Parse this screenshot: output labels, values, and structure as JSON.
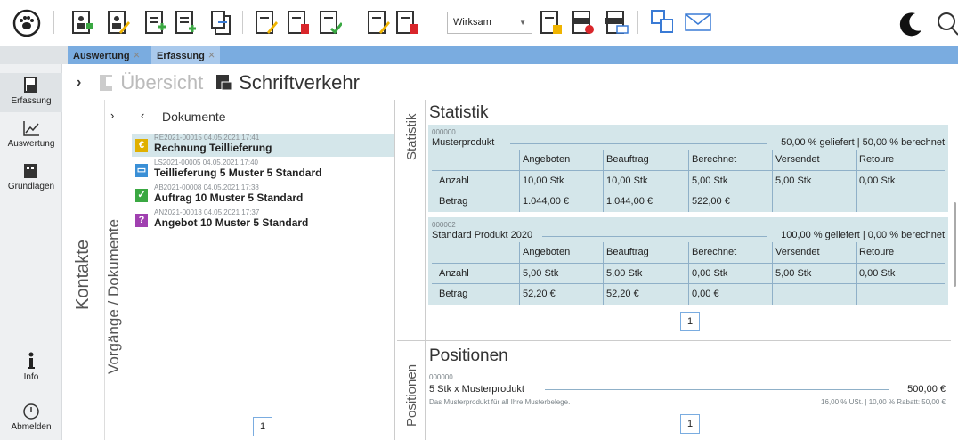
{
  "toolbar": {
    "status_value": "Wirksam",
    "colors": {
      "blue": "#3a7bd5",
      "green": "#3aa842",
      "red": "#d9262b",
      "yellow": "#f0b400",
      "dark": "#333333"
    }
  },
  "tabs": [
    {
      "label": "Auswertung",
      "close": "×"
    },
    {
      "label": "Erfassung",
      "close": "×"
    }
  ],
  "sidebar": {
    "items": [
      {
        "label": "Erfassung",
        "icon": "erfassung-icon"
      },
      {
        "label": "Auswertung",
        "icon": "chart-icon"
      },
      {
        "label": "Grundlagen",
        "icon": "grundlagen-icon"
      },
      {
        "label": "Info",
        "icon": "info-icon"
      },
      {
        "label": "Abmelden",
        "icon": "power-icon"
      }
    ]
  },
  "header": {
    "overview": "Übersicht",
    "correspondence": "Schriftverkehr"
  },
  "columns": {
    "kontakte": "Kontakte",
    "vorgaenge": "Vorgänge / Dokumente",
    "documents_title": "Dokumente"
  },
  "documents": [
    {
      "meta": "RE2021-00015  04.05.2021 17:41",
      "title": "Rechnung Teillieferung",
      "badge": "€",
      "color": "#e0b000"
    },
    {
      "meta": "LS2021-00005  04.05.2021 17:40",
      "title": "Teillieferung 5 Muster 5 Standard",
      "badge": "▭",
      "color": "#3a8fd6"
    },
    {
      "meta": "AB2021-00008  04.05.2021 17:38",
      "title": "Auftrag 10 Muster 5 Standard",
      "badge": "✓",
      "color": "#3aa842"
    },
    {
      "meta": "AN2021-00013  04.05.2021 17:37",
      "title": "Angebot 10 Muster 5 Standard",
      "badge": "?",
      "color": "#a040b0"
    }
  ],
  "documents_page": "1",
  "statistik": {
    "side_label": "Statistik",
    "title": "Statistik",
    "headers": [
      "Angeboten",
      "Beauftrag",
      "Berechnet",
      "Versendet",
      "Retoure"
    ],
    "cards": [
      {
        "id": "000000",
        "name": "Musterprodukt",
        "summary": "50,00 % geliefert | 50,00 % berechnet",
        "rows": [
          {
            "label": "Anzahl",
            "values": [
              "10,00 Stk",
              "10,00 Stk",
              "5,00 Stk",
              "5,00 Stk",
              "0,00 Stk"
            ]
          },
          {
            "label": "Betrag",
            "values": [
              "1.044,00 €",
              "1.044,00 €",
              "522,00 €",
              "",
              ""
            ]
          }
        ]
      },
      {
        "id": "000002",
        "name": "Standard Produkt 2020",
        "summary": "100,00 % geliefert | 0,00 % berechnet",
        "rows": [
          {
            "label": "Anzahl",
            "values": [
              "5,00 Stk",
              "5,00 Stk",
              "0,00 Stk",
              "5,00 Stk",
              "0,00 Stk"
            ]
          },
          {
            "label": "Betrag",
            "values": [
              "52,20 €",
              "52,20 €",
              "0,00 €",
              "",
              ""
            ]
          }
        ]
      }
    ],
    "page": "1"
  },
  "positionen": {
    "side_label": "Positionen",
    "title": "Positionen",
    "item": {
      "id": "000000",
      "name": "5 Stk x Musterprodukt",
      "amount": "500,00 €",
      "description": "Das Musterprodukt für all Ihre Musterbelege.",
      "tax": "16,00 % USt. | 10,00 % Rabatt: 50,00 €"
    },
    "page": "1"
  }
}
